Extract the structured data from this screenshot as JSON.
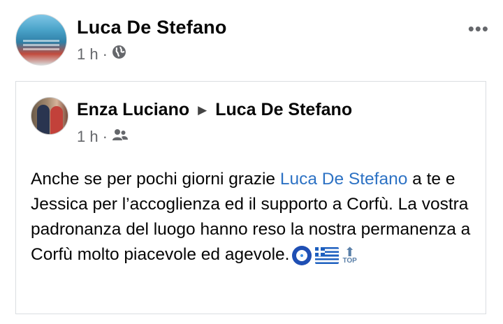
{
  "post": {
    "author": "Luca De Stefano",
    "time": "1 h",
    "separator": "·",
    "visibility_icon": "globe-icon",
    "more_label": "•••"
  },
  "shared": {
    "author": "Enza Luciano",
    "arrow": "▶",
    "target": "Luca De Stefano",
    "time": "1 h",
    "separator": "·",
    "visibility_icon": "friends-icon",
    "text": {
      "part1": "Anche se per pochi giorni grazie ",
      "mention": "Luca De Stefano",
      "part2": " a te e Jessica per l’accoglienza ed il supporto a Corfù. La vostra padronanza del luogo hanno reso la nostra permanenza a Corfù molto piacevole ed agevole.",
      "emoji": [
        "nazar-amulet-emoji",
        "greece-flag-emoji",
        "top-arrow-emoji"
      ],
      "top_label": "TOP"
    }
  },
  "colors": {
    "text": "#050505",
    "meta": "#65676b",
    "mention": "#2d72c4",
    "border": "#dadde1"
  }
}
